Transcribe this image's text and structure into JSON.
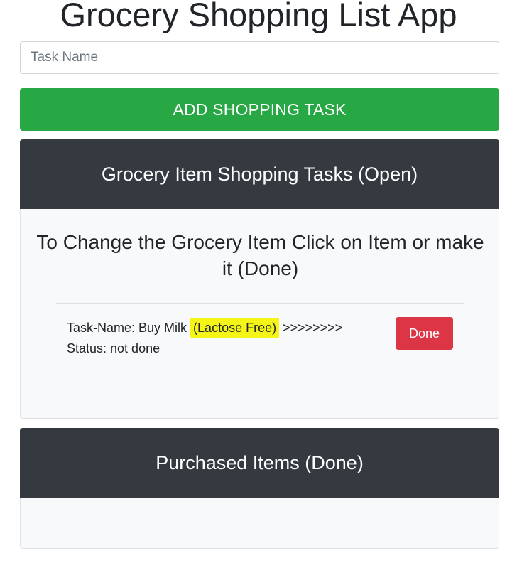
{
  "app": {
    "title": "Grocery Shopping List App"
  },
  "form": {
    "task_input": {
      "value": "",
      "placeholder": "Task Name"
    },
    "add_button_label": "ADD SHOPPING TASK"
  },
  "open_tasks": {
    "header": "Grocery Item Shopping Tasks (Open)",
    "instruction": "To Change the Grocery Item Click on Item or make it (Done)",
    "items": [
      {
        "name_prefix": "Task-Name: Buy Milk ",
        "name_highlighted": "(Lactose Free)",
        "name_suffix": " >>>>>>>>",
        "status_label": "Status: not done",
        "done_button_label": "Done"
      }
    ]
  },
  "done_tasks": {
    "header": "Purchased Items (Done)",
    "items": []
  },
  "colors": {
    "add_button": "#28a745",
    "panel_header": "#343a40",
    "done_button": "#dc3545",
    "highlight": "#f5f518"
  }
}
